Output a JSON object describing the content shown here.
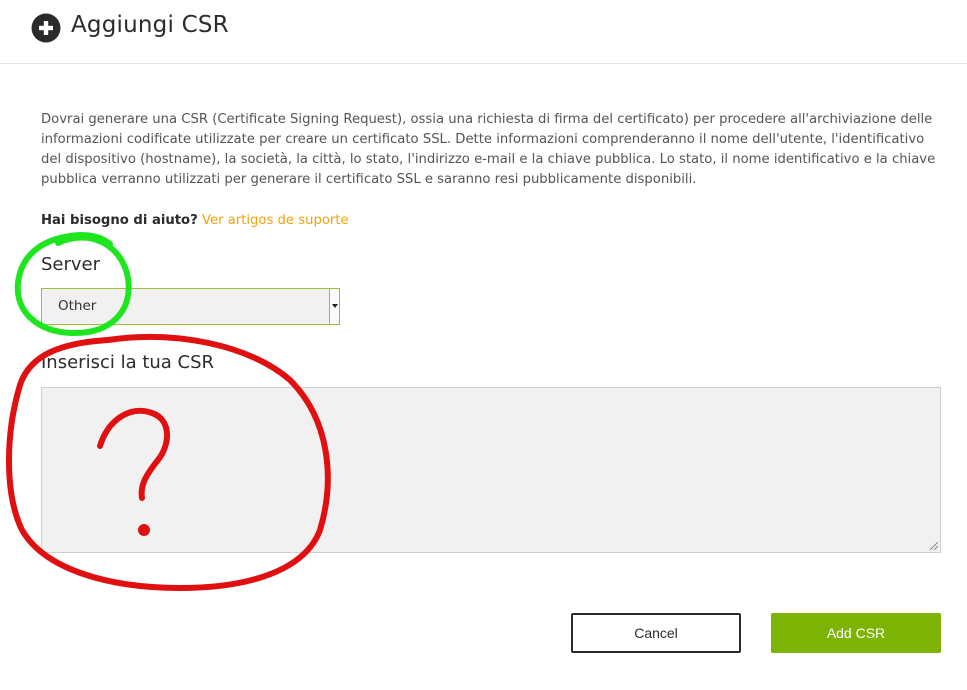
{
  "header": {
    "title": "Aggiungi CSR",
    "icon": "plus-circle-icon"
  },
  "description": "Dovrai generare una CSR (Certificate Signing Request), ossia una richiesta di firma del certificato) per procedere all'archiviazione delle informazioni codificate utilizzate per creare un certificato SSL. Dette informazioni comprenderanno il nome dell'utente, l'identificativo del dispositivo (hostname), la società, la città, lo stato, l'indirizzo e-mail e la chiave pubblica. Lo stato, il nome identificativo e la chiave pubblica verranno utilizzati per generare il certificato SSL e saranno resi pubblicamente disponibili.",
  "help": {
    "label": "Hai bisogno di aiuto?",
    "link": "Ver artigos de suporte",
    "link_color": "#f0a30a"
  },
  "server": {
    "label": "Server",
    "selected": "Other"
  },
  "csr": {
    "label": "Inserisci la tua CSR",
    "value": ""
  },
  "buttons": {
    "cancel": "Cancel",
    "add": "Add CSR",
    "add_color": "#7cb305"
  },
  "annotations": {
    "green_circle_color": "#1ee61e",
    "red_circle_color": "#e01010"
  }
}
